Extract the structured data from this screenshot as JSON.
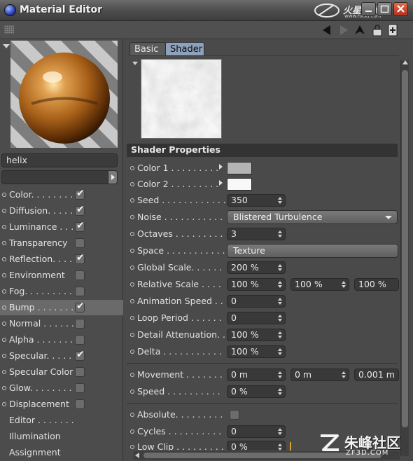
{
  "window": {
    "title": "Material Editor",
    "logo_text": "火星时代",
    "logo_sub": "www.hxsd.com"
  },
  "material_name": "helix",
  "channels": [
    {
      "label": "Color. . . . . . . .",
      "checked": true
    },
    {
      "label": "Diffusion. . . . .",
      "checked": true
    },
    {
      "label": "Luminance . . .",
      "checked": true
    },
    {
      "label": "Transparency",
      "checked": false
    },
    {
      "label": "Reflection. . . .",
      "checked": true
    },
    {
      "label": "Environment",
      "checked": false
    },
    {
      "label": "Fog. . . . . . . . .",
      "checked": false
    },
    {
      "label": "Bump . . . . . . .",
      "checked": true
    },
    {
      "label": "Normal . . . . . .",
      "checked": false
    },
    {
      "label": "Alpha . . . . . . .",
      "checked": false
    },
    {
      "label": "Specular. . . . .",
      "checked": true
    },
    {
      "label": "Specular Color",
      "checked": false
    },
    {
      "label": "Glow. . . . . . . .",
      "checked": false
    },
    {
      "label": "Displacement",
      "checked": false
    },
    {
      "label": "Editor . . . . . . .",
      "checked": null
    },
    {
      "label": "Illumination",
      "checked": null
    },
    {
      "label": "Assignment",
      "checked": null
    }
  ],
  "active_channel": "Bump",
  "tabs": {
    "basic": "Basic",
    "shader": "Shader"
  },
  "shader": {
    "section_title": "Shader Properties",
    "color1_label": "Color 1 . . . . . . . . .",
    "color1_value": "#b4b4b4",
    "color2_label": "Color 2 . . . . . . . . .",
    "color2_value": "#f8f8f8",
    "seed_label": "Seed . . . . . . . . . . . .",
    "seed_value": "350",
    "noise_label": "Noise . . . . . . . . . . .",
    "noise_value": "Blistered Turbulence",
    "octaves_label": "Octaves . . . . . . . . .",
    "octaves_value": "3",
    "space_label": "Space . . . . . . . . . . .",
    "space_value": "Texture",
    "global_scale_label": "Global Scale. . . . . .",
    "global_scale_value": "200 %",
    "relative_scale_label": "Relative Scale . . . .",
    "relative_scale_values": [
      "100 %",
      "100 %",
      "100 %"
    ],
    "animation_speed_label": "Animation Speed . . .",
    "animation_speed_value": "0",
    "loop_period_label": "Loop Period . . . . . .",
    "loop_period_value": "0",
    "detail_attenuation_label": "Detail Attenuation. .",
    "detail_attenuation_value": "100 %",
    "delta_label": "Delta . . . . . . . . . . .",
    "delta_value": "100 %",
    "movement_label": "Movement . . . . . . .",
    "movement_values": [
      "0 m",
      "0 m",
      "0.001 m"
    ],
    "speed_label": "Speed . . . . . . . . . .",
    "speed_value": "0 %",
    "absolute_label": "Absolute. . . . . . . . .",
    "cycles_label": "Cycles . . . . . . . . . .",
    "cycles_value": "0",
    "low_clip_label": "Low Clip . . . . . . . . .",
    "low_clip_value": "0 %"
  },
  "watermark": {
    "text": "朱峰社区",
    "sub": "ZF3D.COM"
  },
  "colors": {
    "tab_active": "#8ea2bd",
    "sphere": "#c07828",
    "close": "#d04020"
  }
}
